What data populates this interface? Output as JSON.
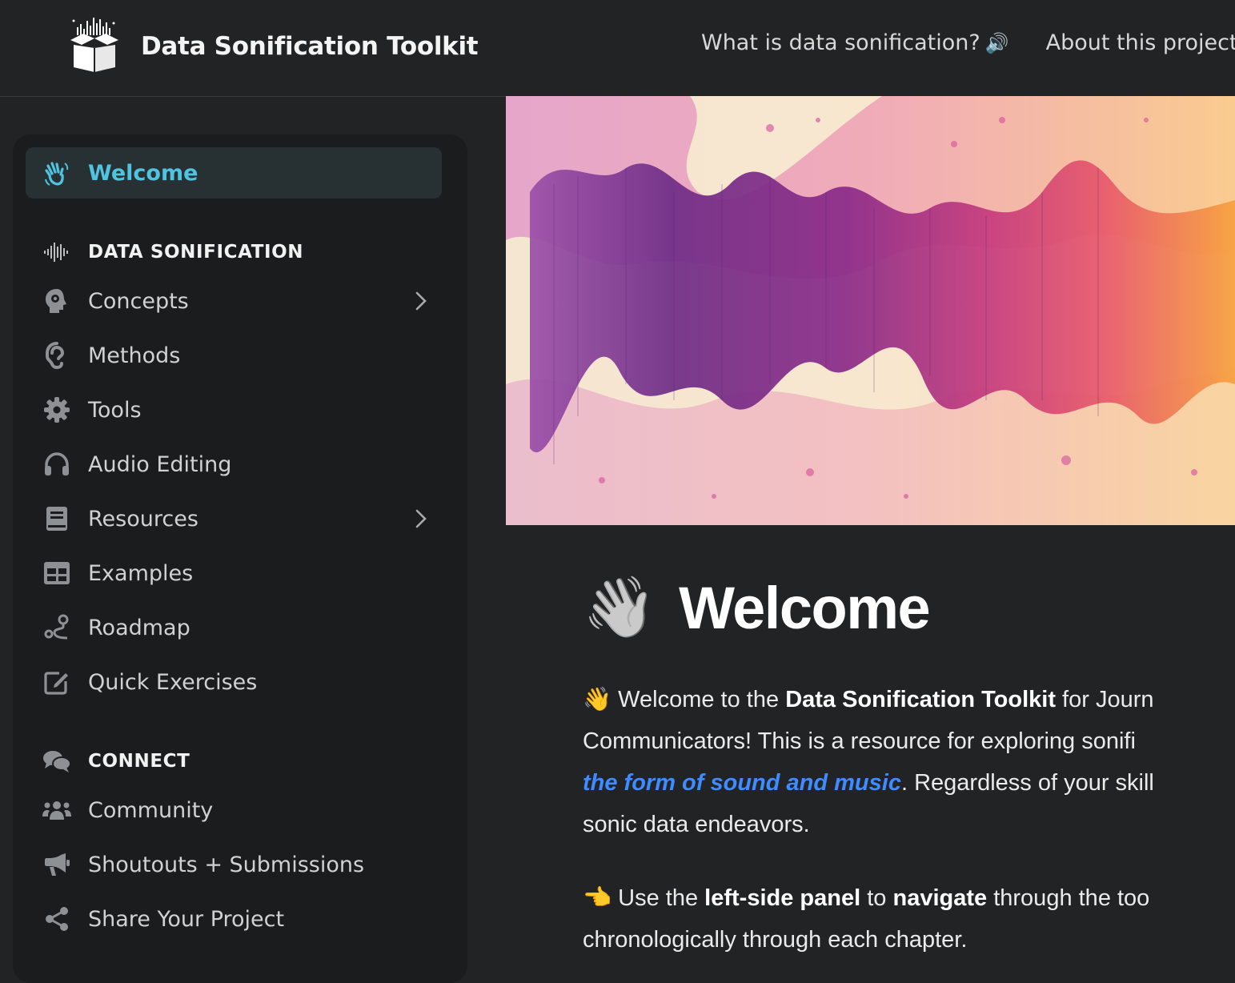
{
  "header": {
    "brand": "Data Sonification Toolkit",
    "nav": [
      {
        "label": "What is data sonification?",
        "icon": "speaker-icon"
      },
      {
        "label": "About this project",
        "icon": ""
      }
    ]
  },
  "sidebar": {
    "welcome": {
      "label": "Welcome",
      "icon": "waving-hand-icon"
    },
    "sections": [
      {
        "title": "DATA SONIFICATION",
        "icon": "waveform-icon",
        "items": [
          {
            "label": "Concepts",
            "icon": "head-gear-icon",
            "expandable": true
          },
          {
            "label": "Methods",
            "icon": "ear-icon",
            "expandable": false
          },
          {
            "label": "Tools",
            "icon": "gear-icon",
            "expandable": false
          },
          {
            "label": "Audio Editing",
            "icon": "headphones-icon",
            "expandable": false
          },
          {
            "label": "Resources",
            "icon": "book-icon",
            "expandable": true
          },
          {
            "label": "Examples",
            "icon": "grid-icon",
            "expandable": false
          },
          {
            "label": "Roadmap",
            "icon": "route-icon",
            "expandable": false
          },
          {
            "label": "Quick Exercises",
            "icon": "edit-icon",
            "expandable": false
          }
        ]
      },
      {
        "title": "CONNECT",
        "icon": "chat-bubbles-icon",
        "items": [
          {
            "label": "Community",
            "icon": "users-icon",
            "expandable": false
          },
          {
            "label": "Shoutouts + Submissions",
            "icon": "megaphone-icon",
            "expandable": false
          },
          {
            "label": "Share Your Project",
            "icon": "share-icon",
            "expandable": false
          }
        ]
      }
    ]
  },
  "main": {
    "title": "Welcome",
    "title_emoji": "👋",
    "p1": {
      "emoji": "👋",
      "t1": "Welcome to the ",
      "b1": "Data Sonification Toolkit",
      "t2": " for Journ",
      "l2": "Communicators! This is a resource for exploring sonifi",
      "link": "the form of sound and music",
      "t3": ". Regardless of your skill",
      "l4": "sonic data endeavors."
    },
    "p2": {
      "emoji": "👈",
      "t1": "Use the ",
      "b1": "left-side panel",
      "t2": " to ",
      "b2": "navigate",
      "t3": " through the too",
      "l2": "chronologically through each chapter."
    }
  },
  "colors": {
    "background": "#222324",
    "sidebar": "#1b1c1d",
    "active_item_bg": "#273134",
    "active_item_text": "#4fc3e0",
    "link": "#3e8cff"
  }
}
